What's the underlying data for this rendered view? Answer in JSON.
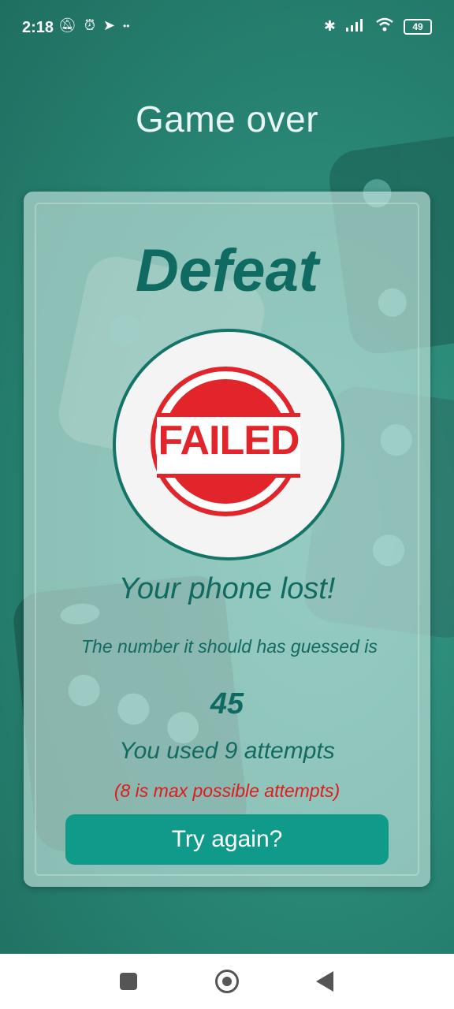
{
  "status_bar": {
    "time": "2:18",
    "left_icons": [
      "mute-vibrate-icon",
      "alarm-icon",
      "telegram-icon",
      "data-icon"
    ],
    "right_icons": [
      "bluetooth-icon",
      "signal-icon",
      "wifi-icon"
    ],
    "battery": "49"
  },
  "page": {
    "title": "Game over"
  },
  "result": {
    "heading": "Defeat",
    "stamp_text": "FAILED",
    "message": "Your phone lost!",
    "guess_label": "The number it should has guessed is",
    "number": "45",
    "attempts_text": "You used 9 attempts",
    "max_attempts_text": "(8 is max possible attempts)",
    "retry_label": "Try again?"
  },
  "colors": {
    "accent": "#0f9a8a",
    "heading": "#0f6b62",
    "warning": "#e11b1b",
    "stamp": "#e1252b"
  },
  "nav_bar": {
    "icons": [
      "recent-apps-icon",
      "home-icon",
      "back-icon"
    ]
  }
}
